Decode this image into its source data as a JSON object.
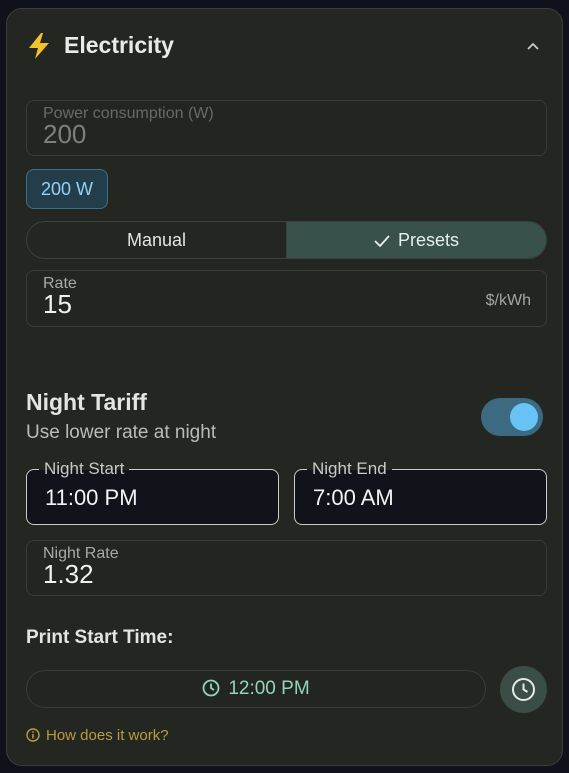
{
  "header": {
    "title": "Electricity",
    "icon": "lightning-bolt-icon",
    "collapse_icon": "chevron-up-icon"
  },
  "power": {
    "label": "Power consumption (W)",
    "value": "200",
    "chip": "200 W"
  },
  "mode_toggle": {
    "options": [
      "Manual",
      "Presets"
    ],
    "selected": "Presets"
  },
  "rate": {
    "label": "Rate",
    "value": "15",
    "unit": "$/kWh"
  },
  "night_tariff": {
    "title": "Night Tariff",
    "subtitle": "Use lower rate at night",
    "enabled": true,
    "start_label": "Night Start",
    "start_value": "11:00 PM",
    "end_label": "Night End",
    "end_value": "7:00 AM",
    "rate_label": "Night Rate",
    "rate_value": "1.32"
  },
  "print_start": {
    "label": "Print Start Time:",
    "value": "12:00 PM"
  },
  "help": {
    "label": "How does it work?"
  },
  "colors": {
    "accent_blue": "#69c4f5",
    "accent_green": "#8fd7b8",
    "help_gold": "#b59d3f"
  }
}
